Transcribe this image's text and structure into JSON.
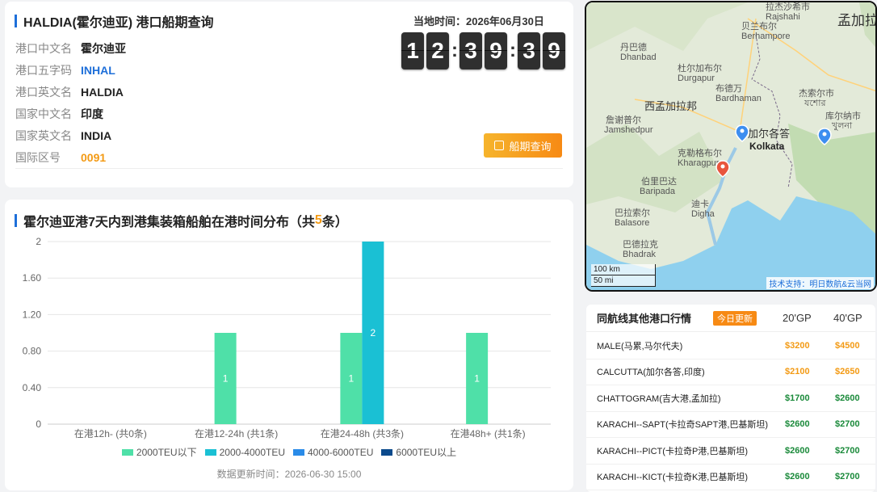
{
  "port_info": {
    "title": "HALDIA(霍尔迪亚) 港口船期查询",
    "rows": [
      {
        "key": "港口中文名",
        "value": "霍尔迪亚"
      },
      {
        "key": "港口五字码",
        "value": "INHAL"
      },
      {
        "key": "港口英文名",
        "value": "HALDIA"
      },
      {
        "key": "国家中文名",
        "value": "印度"
      },
      {
        "key": "国家英文名",
        "value": "INDIA"
      },
      {
        "key": "国际区号",
        "value": "0091"
      }
    ],
    "local_time_label": "当地时间：",
    "local_date": "2026年06月30日",
    "clock_digits": [
      "1",
      "2",
      "3",
      "9",
      "3",
      "9"
    ],
    "schedule_button": "船期查询"
  },
  "chart_section": {
    "title_prefix": "霍尔迪亚港7天内到港集装箱船舶在港时间分布（共",
    "title_count": "5",
    "title_suffix": "条）",
    "update_time": "数据更新时间：2026-06-30 15:00"
  },
  "chart_data": {
    "type": "bar",
    "categories": [
      "在港12h- (共0条)",
      "在港12-24h (共1条)",
      "在港24-48h (共3条)",
      "在港48h+ (共1条)"
    ],
    "series": [
      {
        "name": "2000TEU以下",
        "color": "#4fe0a8",
        "values": [
          0,
          1,
          1,
          1
        ]
      },
      {
        "name": "2000-4000TEU",
        "color": "#1ac0d4",
        "values": [
          0,
          0,
          2,
          0
        ]
      },
      {
        "name": "4000-6000TEU",
        "color": "#2a8be8",
        "values": [
          0,
          0,
          0,
          0
        ]
      },
      {
        "name": "6000TEU以上",
        "color": "#0b4a8c",
        "values": [
          0,
          0,
          0,
          0
        ]
      }
    ],
    "yticks": [
      "0",
      "0.40",
      "0.80",
      "1.20",
      "1.60",
      "2"
    ],
    "ylim": [
      0,
      2
    ],
    "grid": true,
    "legend": "bottom"
  },
  "map": {
    "labels": [
      {
        "text": "拉杰沙希市",
        "cls": ""
      },
      {
        "text": "Rajshahi",
        "cls": ""
      },
      {
        "text": "孟加拉",
        "cls": "big"
      },
      {
        "text": "贝兰布尔",
        "cls": ""
      },
      {
        "text": "Berhampore",
        "cls": ""
      },
      {
        "text": "丹巴德",
        "cls": ""
      },
      {
        "text": "Dhanbad",
        "cls": ""
      },
      {
        "text": "杜尔加布尔",
        "cls": ""
      },
      {
        "text": "Durgapur",
        "cls": ""
      },
      {
        "text": "布德万",
        "cls": ""
      },
      {
        "text": "Bardhaman",
        "cls": ""
      },
      {
        "text": "杰索尔市",
        "cls": ""
      },
      {
        "text": "যশোর",
        "cls": ""
      },
      {
        "text": "西孟加拉邦",
        "cls": "big"
      },
      {
        "text": "库尔纳市",
        "cls": ""
      },
      {
        "text": "খুলনা",
        "cls": ""
      },
      {
        "text": "詹谢普尔",
        "cls": ""
      },
      {
        "text": "Jamshedpur",
        "cls": ""
      },
      {
        "text": "加尔各答",
        "cls": "big"
      },
      {
        "text": "Kolkata",
        "cls": "city"
      },
      {
        "text": "克勒格布尔",
        "cls": ""
      },
      {
        "text": "Kharagpur",
        "cls": ""
      },
      {
        "text": "伯里巴达",
        "cls": ""
      },
      {
        "text": "Baripada",
        "cls": ""
      },
      {
        "text": "迪卡",
        "cls": ""
      },
      {
        "text": "Digha",
        "cls": ""
      },
      {
        "text": "巴拉索尔",
        "cls": ""
      },
      {
        "text": "Balasore",
        "cls": ""
      },
      {
        "text": "巴德拉克",
        "cls": ""
      },
      {
        "text": "Bhadrak",
        "cls": ""
      }
    ],
    "scale_km": "100 km",
    "scale_mi": "50 mi",
    "credit": "技术支持：明日数航&云当网"
  },
  "routes": {
    "title": "同航线其他港口行情",
    "badge": "今日更新",
    "col1": "20'GP",
    "col2": "40'GP",
    "rows": [
      {
        "port": "MALE(马累,马尔代夫)",
        "gp20": "$3200",
        "gp40": "$4500",
        "color": "orange"
      },
      {
        "port": "CALCUTTA(加尔各答,印度)",
        "gp20": "$2100",
        "gp40": "$2650",
        "color": "orange"
      },
      {
        "port": "CHATTOGRAM(吉大港,孟加拉)",
        "gp20": "$1700",
        "gp40": "$2600",
        "color": "green"
      },
      {
        "port": "KARACHI--SAPT(卡拉奇SAPT港,巴基斯坦)",
        "gp20": "$2600",
        "gp40": "$2700",
        "color": "green"
      },
      {
        "port": "KARACHI--PICT(卡拉奇P港,巴基斯坦)",
        "gp20": "$2600",
        "gp40": "$2700",
        "color": "green"
      },
      {
        "port": "KARACHI--KICT(卡拉奇K港,巴基斯坦)",
        "gp20": "$2600",
        "gp40": "$2700",
        "color": "green"
      }
    ]
  }
}
